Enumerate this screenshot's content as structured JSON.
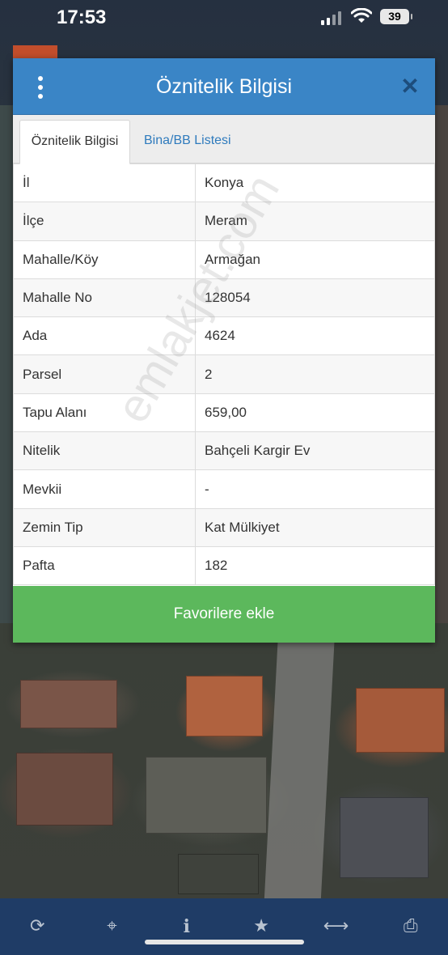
{
  "status_bar": {
    "time": "17:53",
    "battery": "39"
  },
  "dialog": {
    "title": "Öznitelik Bilgisi",
    "tabs": [
      {
        "label": "Öznitelik Bilgisi",
        "active": true
      },
      {
        "label": "Bina/BB Listesi",
        "active": false
      }
    ],
    "rows": [
      {
        "key": "İl",
        "value": "Konya"
      },
      {
        "key": "İlçe",
        "value": "Meram"
      },
      {
        "key": "Mahalle/Köy",
        "value": "Armağan"
      },
      {
        "key": "Mahalle No",
        "value": "128054"
      },
      {
        "key": "Ada",
        "value": "4624"
      },
      {
        "key": "Parsel",
        "value": "2"
      },
      {
        "key": "Tapu Alanı",
        "value": "659,00"
      },
      {
        "key": "Nitelik",
        "value": "Bahçeli Kargir Ev"
      },
      {
        "key": "Mevkii",
        "value": "-"
      },
      {
        "key": "Zemin Tip",
        "value": "Kat Mülkiyet"
      },
      {
        "key": "Pafta",
        "value": "182"
      }
    ],
    "favorite_button": "Favorilere ekle"
  },
  "watermark": "emlakjet.com",
  "toolbar": {
    "icons": [
      "refresh-icon",
      "crosshair-icon",
      "info-icon",
      "star-icon",
      "measure-icon",
      "print-icon"
    ]
  },
  "colors": {
    "header": "#3a85c6",
    "favorite": "#5cb85c",
    "toolbar": "#1f3c66",
    "tab_link": "#2f7bbd"
  }
}
